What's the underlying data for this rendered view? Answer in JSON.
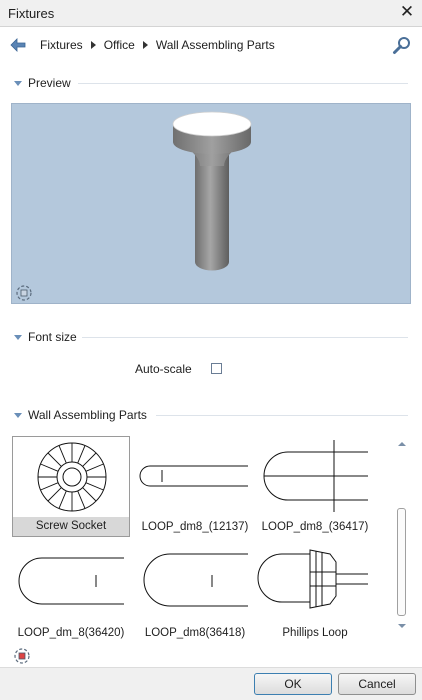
{
  "window": {
    "title": "Fixtures",
    "close_icon": "close-icon"
  },
  "breadcrumb": {
    "items": [
      "Fixtures",
      "Office",
      "Wall Assembling Parts"
    ]
  },
  "sections": {
    "preview": "Preview",
    "font_size": "Font size",
    "parts": "Wall Assembling Parts"
  },
  "font_size": {
    "auto_scale_label": "Auto-scale",
    "auto_scale_checked": false
  },
  "parts": [
    {
      "label": "Screw Socket",
      "selected": true
    },
    {
      "label": "LOOP_dm8_(12137)",
      "selected": false
    },
    {
      "label": "LOOP_dm8_(36417)",
      "selected": false
    },
    {
      "label": "LOOP_dm_8(36420)",
      "selected": false
    },
    {
      "label": "LOOP_dm8(36418)",
      "selected": false
    },
    {
      "label": "Phillips Loop",
      "selected": false
    }
  ],
  "buttons": {
    "ok": "OK",
    "cancel": "Cancel"
  },
  "colors": {
    "preview_bg": "#b4c8dc",
    "accent": "#3c7fb1"
  }
}
